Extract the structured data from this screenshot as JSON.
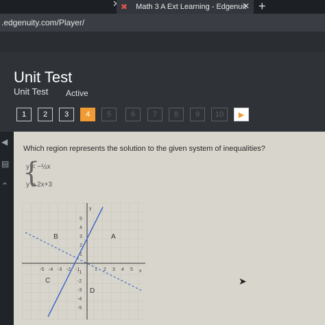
{
  "browser": {
    "tab_title": "Math 3 A Ext Learning - Edgenuit",
    "tab_close": "✕",
    "prev_close": "✕",
    "new_tab": "+",
    "url": ".edgenuity.com/Player/"
  },
  "header": {
    "title": "Unit Test",
    "subtitle": "Unit Test",
    "status": "Active"
  },
  "question_nav": [
    "1",
    "2",
    "3",
    "4",
    "5",
    "6",
    "7",
    "8",
    "9",
    "10"
  ],
  "question_nav_active": "4",
  "next_icon": "▶",
  "question": {
    "text": "Which region represents the solution to the given system of inequalities?",
    "ineq1": "y < −½x",
    "ineq2": "y ≥ 2x+3"
  },
  "graph": {
    "x_label": "x",
    "y_label": "y",
    "x_ticks": [
      "-5",
      "-4",
      "-3",
      "-2",
      "-1",
      "1",
      "2",
      "3",
      "4",
      "5"
    ],
    "y_ticks": [
      "5",
      "4",
      "3",
      "2",
      "1",
      "-1",
      "-2",
      "-3",
      "-4",
      "-5"
    ],
    "regions": {
      "A": "A",
      "B": "B",
      "C": "C",
      "D": "D"
    }
  },
  "colors": {
    "accent": "#f29a34",
    "solid_line": "#3b63c4"
  }
}
